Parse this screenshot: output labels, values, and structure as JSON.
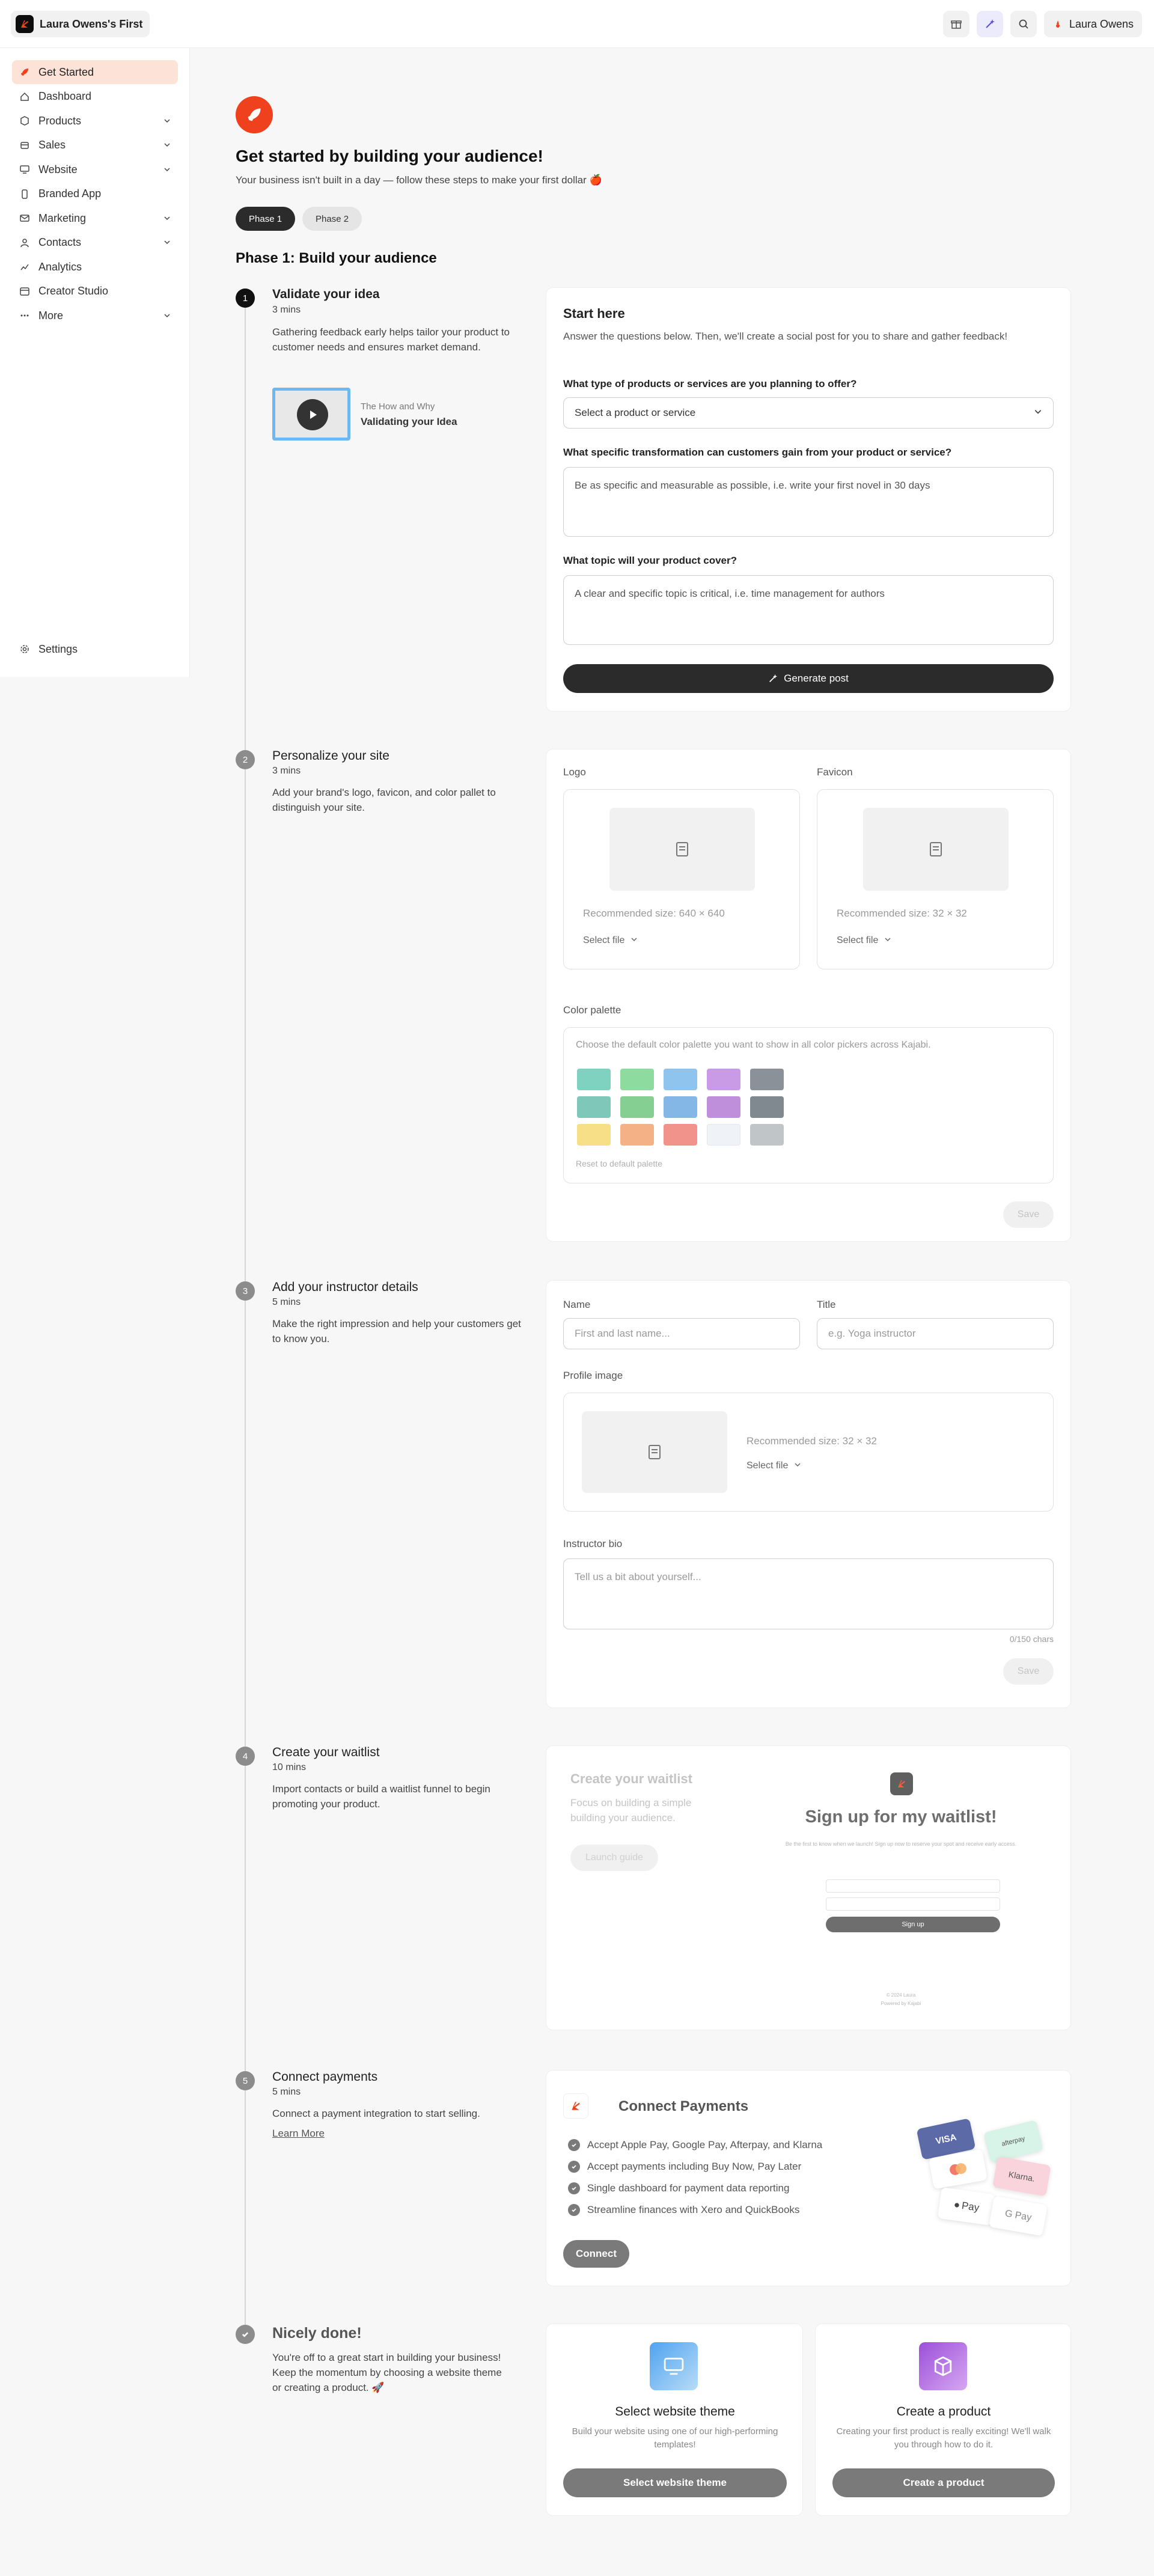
{
  "app": {
    "site_name": "Laura Owens's First",
    "user_name": "Laura Owens"
  },
  "sidebar": {
    "items": [
      {
        "label": "Get Started",
        "icon": "rocket-icon"
      },
      {
        "label": "Dashboard",
        "icon": "dashboard-icon"
      },
      {
        "label": "Products",
        "icon": "box-icon"
      },
      {
        "label": "Sales",
        "icon": "sales-icon"
      },
      {
        "label": "Website",
        "icon": "monitor-icon"
      },
      {
        "label": "Branded App",
        "icon": "phone-icon"
      },
      {
        "label": "Marketing",
        "icon": "mail-icon"
      },
      {
        "label": "Contacts",
        "icon": "users-icon"
      },
      {
        "label": "Analytics",
        "icon": "chart-icon"
      },
      {
        "label": "Creator Studio",
        "icon": "studio-icon"
      },
      {
        "label": "More",
        "icon": "more-icon"
      }
    ],
    "settings": "Settings"
  },
  "header": {
    "title": "Get started by building your audience!",
    "subtitle": "Your business isn't built in a day — follow these steps to make your first dollar 🍎",
    "tabs": [
      "Phase 1",
      "Phase 2"
    ],
    "phase_heading": "Phase 1: Build your audience"
  },
  "steps": [
    {
      "num": "1",
      "title": "Validate your idea",
      "mins": "3 mins",
      "desc": "Gathering feedback early helps tailor your product to customer needs and ensures market demand.",
      "video_kicker": "The How and Why",
      "video_title": "Validating your Idea"
    },
    {
      "num": "2",
      "title": "Personalize your site",
      "mins": "3 mins",
      "desc": "Add your brand's logo, favicon, and color pallet to distinguish your site."
    },
    {
      "num": "3",
      "title": "Add your instructor details",
      "mins": "5 mins",
      "desc": "Make the right impression and help your customers get to know you."
    },
    {
      "num": "4",
      "title": "Create your waitlist",
      "mins": "10 mins",
      "desc": "Import contacts or build a waitlist funnel to begin promoting your product."
    },
    {
      "num": "5",
      "title": "Connect payments",
      "mins": "5 mins",
      "desc": "Connect a payment integration to start selling.",
      "link": "Learn More"
    },
    {
      "title": "Nicely done!",
      "desc": "You're off to a great start in building your business! Keep the momentum by choosing a website theme or creating a product. 🚀"
    }
  ],
  "start_card": {
    "title": "Start here",
    "intro": "Answer the questions below. Then, we'll create a social post for you to share and gather feedback!",
    "q1": "What type of products or services are you planning to offer?",
    "q1_value": "Select a product or service",
    "q2": "What specific transformation can customers gain from your product or service?",
    "q2_placeholder": "Be as specific and measurable as possible, i.e. write your first novel in 30 days",
    "q3": "What topic will your product cover?",
    "q3_placeholder": "A clear and specific topic is critical, i.e. time management for authors",
    "button": "Generate post"
  },
  "personalize_card": {
    "logo_label": "Logo",
    "logo_hint": "Recommended size: 640 × 640",
    "favicon_label": "Favicon",
    "favicon_hint": "Recommended size: 32 × 32",
    "select_file": "Select file",
    "palette_label": "Color palette",
    "palette_hint": "Choose the default color palette you want to show in all color pickers across Kajabi.",
    "reset": "Reset to default palette",
    "save": "Save",
    "swatches": [
      "#7fd1c0",
      "#8edba0",
      "#8ec4ee",
      "#c99ae6",
      "#8a9198",
      "#7fc7b8",
      "#86cf93",
      "#84b7e6",
      "#bf8fdc",
      "#808890",
      "#f7df88",
      "#f4b186",
      "#f1938a",
      "#eff3f7",
      "#c0c6c8"
    ]
  },
  "instructor_card": {
    "name_label": "Name",
    "name_placeholder": "First and last name...",
    "title_label": "Title",
    "title_placeholder": "e.g. Yoga instructor",
    "profile_label": "Profile image",
    "profile_hint": "Recommended size: 32 × 32",
    "select_file": "Select file",
    "bio_label": "Instructor bio",
    "bio_placeholder": "Tell us a bit about yourself...",
    "char_count": "0/150 chars",
    "save": "Save"
  },
  "waitlist_card": {
    "title": "Create your waitlist",
    "desc": "Focus on building a simple building your audience.",
    "button": "Launch guide",
    "preview_title": "Sign up for my waitlist!",
    "preview_sub": "Be the first to know when we launch! Sign up now to reserve your spot and receive early access.",
    "preview_button": "Sign up",
    "preview_footer1": "© 2024 Laura",
    "preview_footer2": "Powered by Kajabi"
  },
  "payments_card": {
    "title": "Connect Payments",
    "bullets": [
      "Accept Apple Pay, Google Pay, Afterpay, and Klarna",
      "Accept payments including Buy Now, Pay Later",
      "Single dashboard for payment data reporting",
      "Streamline finances with Xero and QuickBooks"
    ],
    "button": "Connect",
    "cards": [
      "VISA",
      "afterpay",
      "Klarna.",
      "Pay",
      "G Pay"
    ]
  },
  "done_cards": [
    {
      "title": "Select website theme",
      "desc": "Build your website using one of our high-performing templates!",
      "button": "Select website theme",
      "icon": "monitor-icon"
    },
    {
      "title": "Create a product",
      "desc": "Creating your first product is really exciting! We'll walk you through how to do it.",
      "button": "Create a product",
      "icon": "box-icon"
    }
  ]
}
